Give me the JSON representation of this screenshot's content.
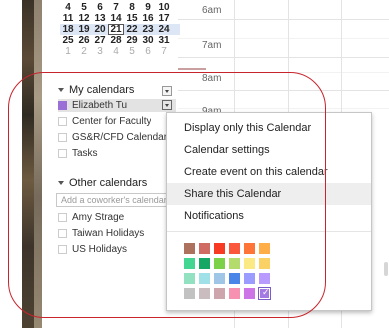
{
  "mini_calendar": {
    "weeks": [
      [
        {
          "d": "4"
        },
        {
          "d": "5"
        },
        {
          "d": "6"
        },
        {
          "d": "7"
        },
        {
          "d": "8"
        },
        {
          "d": "9"
        },
        {
          "d": "10"
        }
      ],
      [
        {
          "d": "11"
        },
        {
          "d": "12"
        },
        {
          "d": "13"
        },
        {
          "d": "14"
        },
        {
          "d": "15"
        },
        {
          "d": "16"
        },
        {
          "d": "17"
        }
      ],
      [
        {
          "d": "18"
        },
        {
          "d": "19"
        },
        {
          "d": "20"
        },
        {
          "d": "21",
          "today": true
        },
        {
          "d": "22"
        },
        {
          "d": "23"
        },
        {
          "d": "24"
        }
      ],
      [
        {
          "d": "25"
        },
        {
          "d": "26"
        },
        {
          "d": "27"
        },
        {
          "d": "28"
        },
        {
          "d": "29"
        },
        {
          "d": "30"
        },
        {
          "d": "31"
        }
      ],
      [
        {
          "d": "1",
          "other": true
        },
        {
          "d": "2",
          "other": true
        },
        {
          "d": "3",
          "other": true
        },
        {
          "d": "4",
          "other": true
        },
        {
          "d": "5",
          "other": true
        },
        {
          "d": "6",
          "other": true
        },
        {
          "d": "7",
          "other": true
        }
      ]
    ]
  },
  "my_calendars": {
    "label": "My calendars",
    "items": [
      {
        "name": "Elizabeth Tu",
        "color": "#9a6fd6",
        "selected": true
      },
      {
        "name": "Center for Faculty",
        "color": "#ffffff"
      },
      {
        "name": "GS&R/CFD Calendar",
        "color": "#ffffff"
      },
      {
        "name": "Tasks",
        "color": "#ffffff"
      }
    ]
  },
  "other_calendars": {
    "label": "Other calendars",
    "add_placeholder": "Add a coworker's calendar",
    "items": [
      {
        "name": "Amy Strage",
        "color": "#ffffff"
      },
      {
        "name": "Taiwan Holidays",
        "color": "#ffffff"
      },
      {
        "name": "US Holidays",
        "color": "#ffffff"
      }
    ]
  },
  "time_grid": {
    "labels": [
      "6am",
      "7am",
      "8am",
      "9am"
    ]
  },
  "context_menu": {
    "items": [
      {
        "label": "Display only this Calendar"
      },
      {
        "label": "Calendar settings"
      },
      {
        "label": "Create event on this calendar"
      },
      {
        "label": "Share this Calendar",
        "highlighted": true
      },
      {
        "label": "Notifications"
      }
    ],
    "colors": [
      [
        "#ac725e",
        "#d06b64",
        "#f83a22",
        "#fa573c",
        "#ff7537",
        "#ffad46"
      ],
      [
        "#42d692",
        "#16a765",
        "#7bd148",
        "#b3dc6c",
        "#fbe983",
        "#fad165"
      ],
      [
        "#92e1c0",
        "#9fe1e7",
        "#9fc6e7",
        "#4986e7",
        "#9a9cff",
        "#b99aff"
      ],
      [
        "#c2c2c2",
        "#cabdbf",
        "#cca6ac",
        "#f691b2",
        "#cd74e6",
        "#a47ae2"
      ]
    ],
    "selected_color": "#a47ae2"
  },
  "annotation_color": "#c8242c"
}
